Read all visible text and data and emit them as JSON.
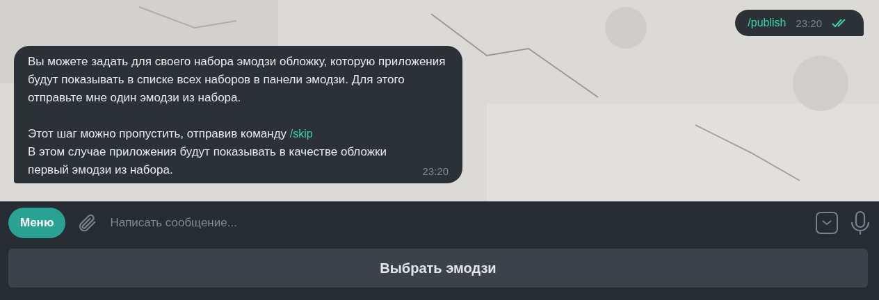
{
  "outgoing": {
    "text": "/publish",
    "time": "23:20",
    "read": true
  },
  "incoming": {
    "paragraphs": [
      {
        "text": "Вы можете задать для своего набора эмодзи обложку, которую приложения будут показывать в списке всех наборов в панели эмодзи. Для этого отправьте мне один эмодзи из набора."
      },
      {
        "text": "Этот шаг можно пропустить, отправив команду",
        "link": "/skip"
      },
      {
        "text": "В этом случае приложения будут показывать в качестве обложки первый эмодзи из набора."
      }
    ],
    "time": "23:20"
  },
  "composer": {
    "menu_button": "Меню",
    "placeholder": "Написать сообщение..."
  },
  "keyboard_buttons": [
    "Выбрать эмодзи"
  ]
}
